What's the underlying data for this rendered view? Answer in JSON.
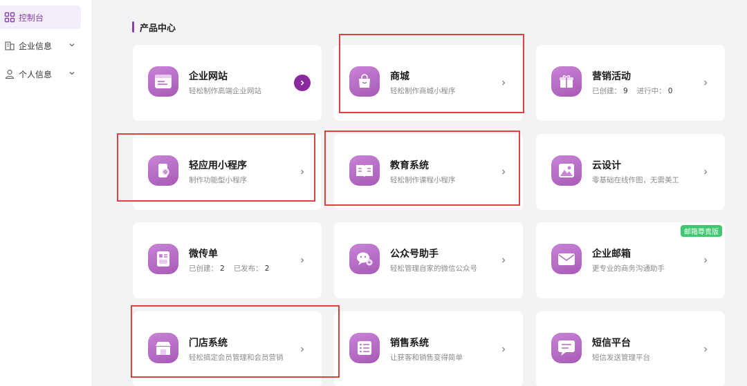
{
  "sidebar": {
    "items": [
      {
        "label": "控制台",
        "icon": "dashboard-grid-icon",
        "active": true
      },
      {
        "label": "企业信息",
        "icon": "building-icon",
        "expandable": true
      },
      {
        "label": "个人信息",
        "icon": "user-icon",
        "expandable": true
      }
    ]
  },
  "main": {
    "section_title": "产品中心",
    "cards": [
      {
        "title": "企业网站",
        "desc": "轻松制作高端企业网站",
        "icon": "website-icon"
      },
      {
        "title": "商城",
        "desc": "轻松制作商城小程序",
        "icon": "shopping-bag-icon"
      },
      {
        "title": "营销活动",
        "desc_parts": {
          "created_label": "已创建：",
          "created_count": "9",
          "running_label": "进行中：",
          "running_count": "0"
        },
        "icon": "gift-icon"
      },
      {
        "title": "轻应用小程序",
        "desc": "制作功能型小程序",
        "icon": "mini-app-icon"
      },
      {
        "title": "教育系统",
        "desc": "轻松制作课程小程序",
        "icon": "book-icon"
      },
      {
        "title": "云设计",
        "desc": "零基础在线作图，无需美工",
        "icon": "image-icon"
      },
      {
        "title": "微传单",
        "desc_parts": {
          "created_label": "已创建：",
          "created_count": "2",
          "published_label": "已发布：",
          "published_count": "2"
        },
        "icon": "flyer-icon"
      },
      {
        "title": "公众号助手",
        "desc": "轻松管理自家的微信公众号",
        "icon": "wechat-icon"
      },
      {
        "title": "企业邮箱",
        "desc": "更专业的商务沟通助手",
        "icon": "mail-icon",
        "badge": "邮箱尊贵版"
      },
      {
        "title": "门店系统",
        "desc": "轻松搞定会员管理和会员营销",
        "icon": "store-icon"
      },
      {
        "title": "销售系统",
        "desc": "让获客和销售变得简单",
        "icon": "sales-list-icon"
      },
      {
        "title": "短信平台",
        "desc": "短信发送管理平台",
        "icon": "sms-icon"
      }
    ]
  },
  "colors": {
    "accent": "#8a3fae",
    "icon_gradient_start": "#c883d6",
    "icon_gradient_end": "#a85ab6",
    "badge": "#3fc86f",
    "highlight_box": "#e04040"
  }
}
